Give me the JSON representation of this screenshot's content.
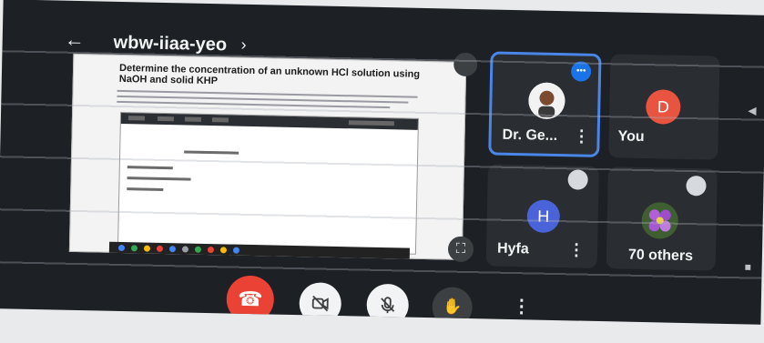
{
  "header": {
    "back_icon": "arrow-left-icon",
    "meeting_code": "wbw-iiaa-yeo",
    "chevron": "›"
  },
  "presentation": {
    "heading": "Determine the concentration of an unknown HCl solution using NaOH and solid KHP",
    "fullscreen_icon": "fullscreen-icon"
  },
  "top_controls": {
    "camera_switch_icon": "camera-switch-icon",
    "speaker_icon": "speaker-icon"
  },
  "participants": [
    {
      "name": "Dr. Ge...",
      "avatar": "photo",
      "speaking": true
    },
    {
      "name": "You",
      "avatar_letter": "D",
      "avatar_color": "#e8543f"
    },
    {
      "name": "Hyfa",
      "avatar_letter": "H",
      "avatar_color": "#4a63d8"
    },
    {
      "name": "70 others",
      "avatar": "flower"
    }
  ],
  "controls": {
    "end_call_icon": "phone-hangup-icon",
    "camera_icon": "camera-off-icon",
    "mic_icon": "mic-off-icon",
    "hand_icon": "raise-hand-icon",
    "more_icon": "more-vertical-icon"
  },
  "colors": {
    "end_call": "#ea4335",
    "speaking_border": "#4a86e8",
    "background": "#1d2024"
  }
}
